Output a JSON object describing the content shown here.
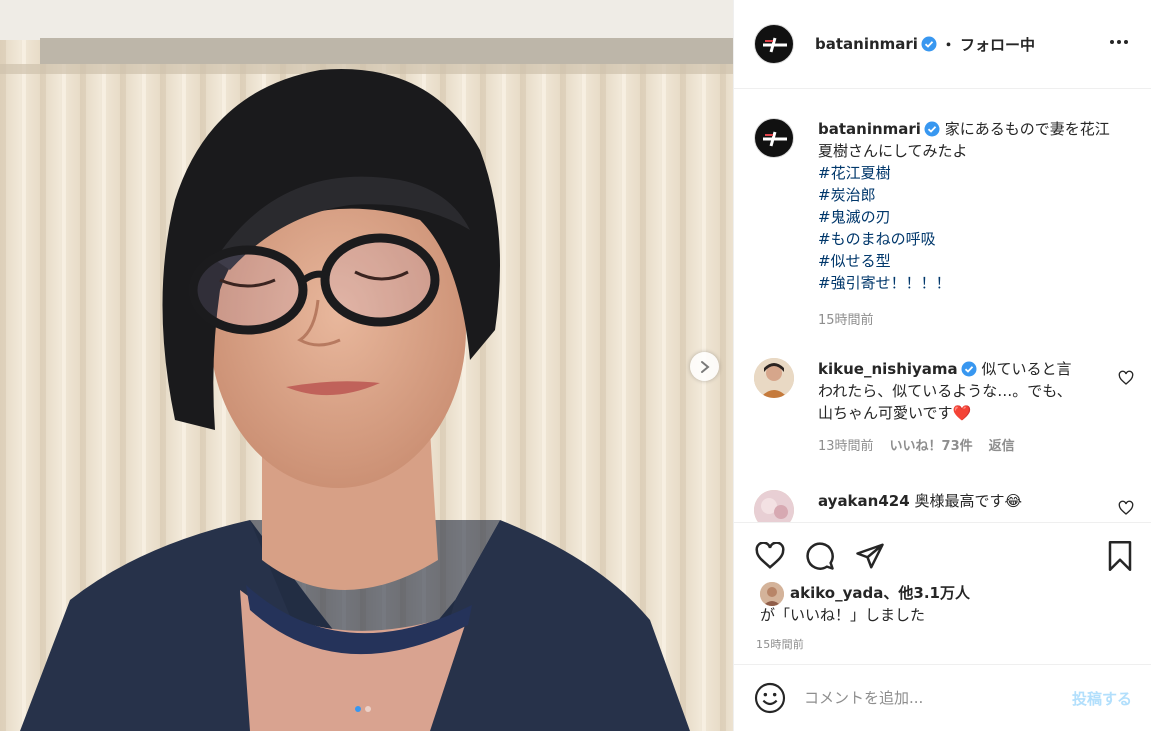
{
  "post": {
    "author": "bataninmari",
    "separator": "・",
    "follow_label": "フォロー中",
    "caption_text": "家にあるもので妻を花江夏樹さんにしてみたよ",
    "hashtags": [
      "#花江夏樹",
      "#炭治郎",
      "#鬼滅の刃",
      "#ものまねの呼吸",
      "#似せる型",
      "#強引寄せ！！！！"
    ],
    "caption_time": "15時間前",
    "carousel": {
      "current": 1,
      "total": 2
    }
  },
  "comments": [
    {
      "user": "kikue_nishiyama",
      "verified": true,
      "text": "似ていると言われたら、似ているような…。でも、山ちゃん可愛いです",
      "emoji": "❤️",
      "time": "13時間前",
      "likes": "いいね！73件",
      "reply": "返信"
    },
    {
      "user": "ayakan424",
      "verified": false,
      "text": "奥様最高です",
      "emoji": "😂"
    }
  ],
  "likes": {
    "user": "akiko_yada",
    "others": "、他3.1万人",
    "suffix": "が「いいね！」しました"
  },
  "post_time": "15時間前",
  "add_comment": {
    "placeholder": "コメントを追加...",
    "post_label": "投稿する"
  },
  "icons": {
    "like": "heart-icon",
    "comment": "comment-icon",
    "share": "share-icon",
    "save": "bookmark-icon",
    "more": "more-options-icon",
    "emoji": "emoji-icon",
    "next": "chevron-right-icon",
    "verified": "verified-badge-icon"
  },
  "colors": {
    "link": "#00376b",
    "verified": "#3897f0",
    "muted": "#8e8e8e",
    "post_disabled": "#b2dffc",
    "text": "#262626"
  }
}
